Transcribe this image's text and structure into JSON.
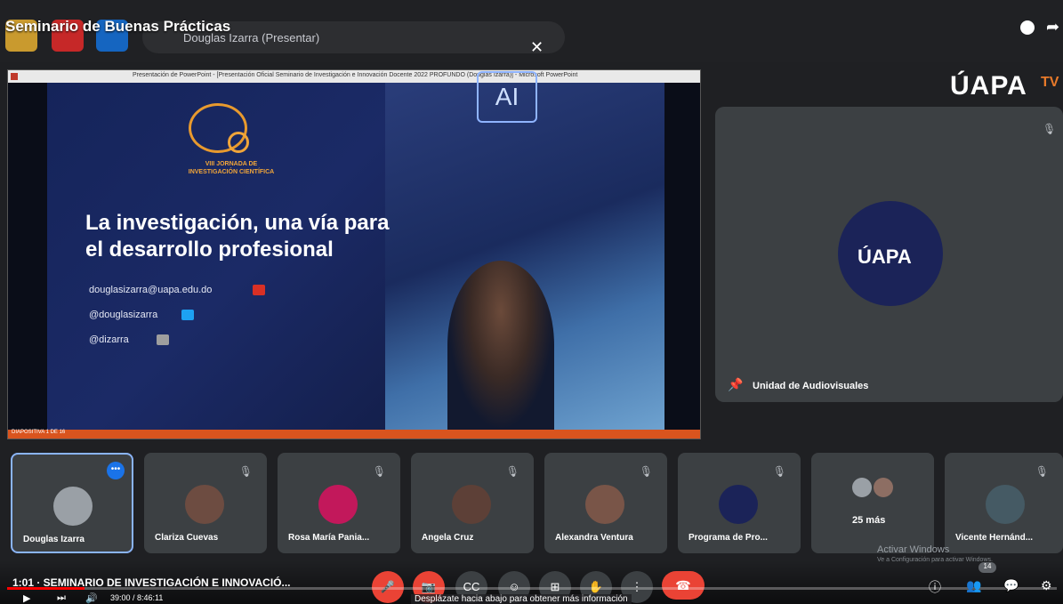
{
  "colors": {
    "accent": "#8ab4f8",
    "danger": "#ea4335",
    "brand_orange": "#e87a2a",
    "slide_bg": "#15245a"
  },
  "video": {
    "title": "Seminario de Buenas Prácticas",
    "chapter": "1:01 · SEMINARIO DE INVESTIGACIÓN E INNOVACIÓ...",
    "time": "39:00 / 8:46:11",
    "progress_fraction": 0.074
  },
  "meet": {
    "presenting_label": "Douglas Izarra (Presentar)",
    "brand": "ÚAPA",
    "brand_suffix": "TV",
    "hint": "Desplázate hacia abajo para obtener más información",
    "participants_badge": "14"
  },
  "ppt": {
    "window_title": "Presentación de PowerPoint - [Presentación Oficial Seminario de Investigación e Innovación Docente 2022 PROFUNDO (Douglas Izarra)] - Microsoft PowerPoint",
    "status_left": "DIAPOSITIVA 1 DE 16"
  },
  "slide": {
    "jornada_line1": "VIII JORNADA DE",
    "jornada_line2": "INVESTIGACIÓN CIENTÍFICA",
    "ai_badge": "AI",
    "heading_line1": "La investigación, una vía para",
    "heading_line2": "el desarrollo profesional",
    "email": "douglasizarra@uapa.edu.do",
    "twitter": "@douglasizarra",
    "instagram": "@dizarra"
  },
  "speaker": {
    "avatar_text": "ÚAPA",
    "name": "Unidad de Audiovisuales"
  },
  "participants": [
    {
      "name": "Douglas Izarra",
      "active": true
    },
    {
      "name": "Clariza Cuevas"
    },
    {
      "name": "Rosa María Pania..."
    },
    {
      "name": "Angela Cruz"
    },
    {
      "name": "Alexandra Ventura"
    },
    {
      "name": "Programa de Pro..."
    },
    {
      "name": "25 más"
    },
    {
      "name": "Vicente Hernánd..."
    }
  ],
  "watermark": {
    "line1": "Activar Windows",
    "line2": "Ve a Configuración para activar Windows."
  }
}
